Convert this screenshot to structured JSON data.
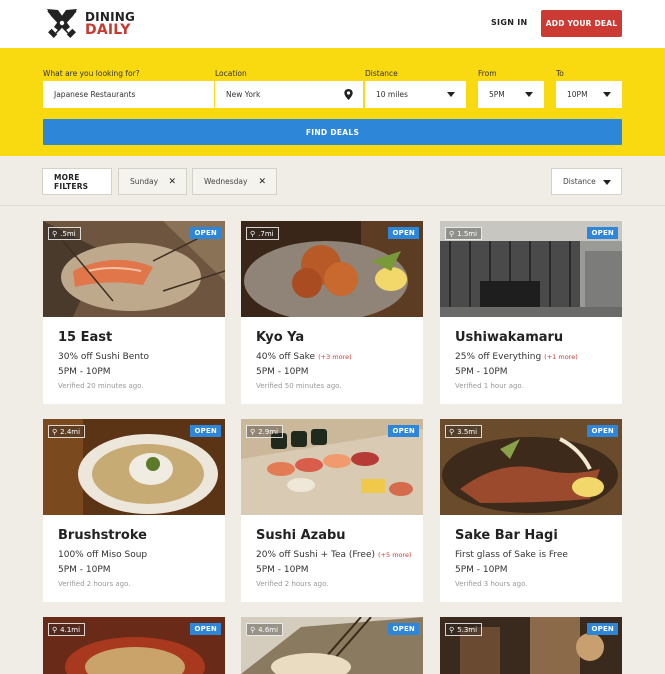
{
  "header": {
    "logo_line1": "DINING",
    "logo_line2": "DAILY",
    "signin": "SIGN IN",
    "add_deal": "ADD YOUR DEAL"
  },
  "search": {
    "what_label": "What are you looking for?",
    "what_value": "Japanese Restaurants",
    "location_label": "Location",
    "location_value": "New York",
    "distance_label": "Distance",
    "distance_value": "10 miles",
    "from_label": "From",
    "from_value": "5PM",
    "to_label": "To",
    "to_value": "10PM",
    "find_button": "FIND DEALS"
  },
  "filters": {
    "more_filters": "MORE FILTERS",
    "chips": [
      "Sunday",
      "Wednesday"
    ],
    "sort": "Distance"
  },
  "colors": {
    "brand_red": "#cc3b33",
    "search_yellow": "#f9d90f",
    "accent_blue": "#2e86d8"
  },
  "cards": [
    {
      "distance": ".5mi",
      "status": "OPEN",
      "name": "15 East",
      "deal": "30% off Sushi Bento",
      "more": "",
      "hours": "5PM - 10PM",
      "verified": "Verified 20 minutes ago.",
      "image": "sushi-slice-photo"
    },
    {
      "distance": ".7mi",
      "status": "OPEN",
      "name": "Kyo Ya",
      "deal": "40% off Sake",
      "more": "(+3 more)",
      "hours": "5PM - 10PM",
      "verified": "Verified 50 minutes ago.",
      "image": "fried-shrimp-photo"
    },
    {
      "distance": "1.5mi",
      "status": "OPEN",
      "name": "Ushiwakamaru",
      "deal": "25% off Everything",
      "more": "(+1 more)",
      "hours": "5PM - 10PM",
      "verified": "Verified 1 hour ago.",
      "image": "storefront-photo"
    },
    {
      "distance": "2.4mi",
      "status": "OPEN",
      "name": "Brushstroke",
      "deal": "100% off Miso Soup",
      "more": "",
      "hours": "5PM - 10PM",
      "verified": "Verified 2 hours ago.",
      "image": "miso-soup-photo"
    },
    {
      "distance": "2.9mi",
      "status": "OPEN",
      "name": "Sushi Azabu",
      "deal": "20% off Sushi + Tea (Free)",
      "more": "(+5 more)",
      "hours": "5PM - 10PM",
      "verified": "Verified 2 hours ago.",
      "image": "sushi-platter-photo"
    },
    {
      "distance": "3.5mi",
      "status": "OPEN",
      "name": "Sake Bar Hagi",
      "deal": "First glass of Sake is Free",
      "more": "",
      "hours": "5PM - 10PM",
      "verified": "Verified 3 hours ago.",
      "image": "seared-fish-photo"
    },
    {
      "distance": "4.1mi",
      "status": "OPEN",
      "image": "noodle-bowl-photo"
    },
    {
      "distance": "4.6mi",
      "status": "OPEN",
      "image": "noodles-chopsticks-photo"
    },
    {
      "distance": "5.3mi",
      "status": "OPEN",
      "image": "kitchen-photo"
    }
  ]
}
